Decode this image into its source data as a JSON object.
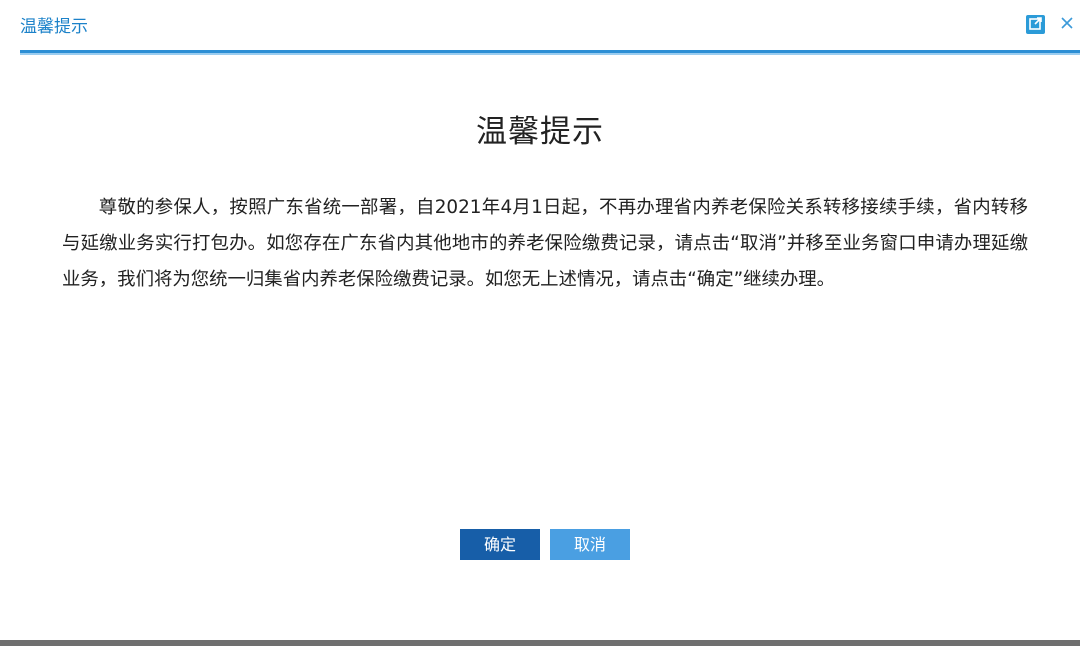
{
  "header": {
    "title": "温馨提示",
    "expand_icon": "external-link-icon",
    "close_icon": "close-icon"
  },
  "content": {
    "title": "温馨提示",
    "body": "尊敬的参保人，按照广东省统一部署，自2021年4月1日起，不再办理省内养老保险关系转移接续手续，省内转移与延缴业务实行打包办。如您存在广东省内其他地市的养老保险缴费记录，请点击“取消”并移至业务窗口申请办理延缴业务，我们将为您统一归集省内养老保险缴费记录。如您无上述情况，请点击“确定”继续办理。"
  },
  "buttons": {
    "confirm_label": "确定",
    "cancel_label": "取消"
  },
  "colors": {
    "accent": "#2d8fd5",
    "title_text": "#1c82c9",
    "confirm_bg": "#175ea8",
    "cancel_bg": "#4a9fe2"
  }
}
